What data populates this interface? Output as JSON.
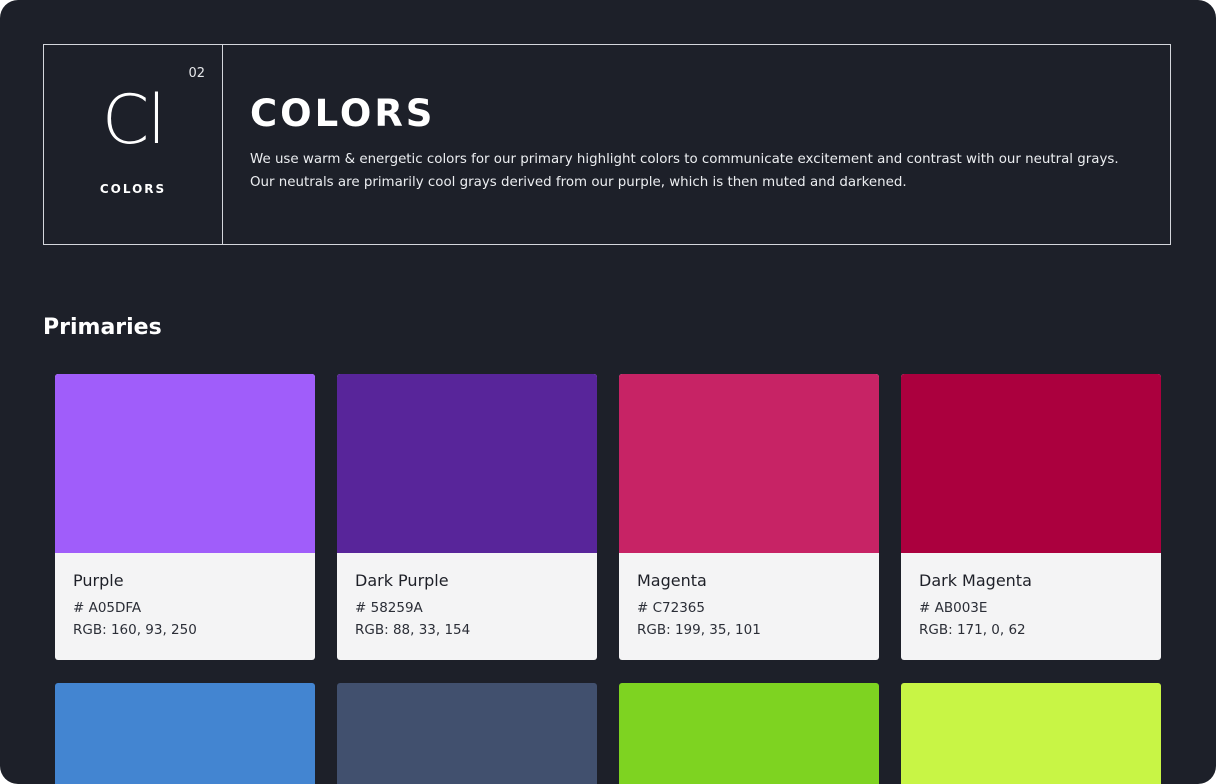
{
  "header": {
    "element_number": "02",
    "element_symbol": "Cl",
    "element_name": "COLORS",
    "title": "COLORS",
    "description_line1": "We use warm & energetic colors for our primary highlight colors to communicate excitement and contrast with our neutral grays.",
    "description_line2": "Our neutrals are primarily cool grays derived from our purple, which is then muted and darkened."
  },
  "section": {
    "title": "Primaries"
  },
  "swatches": [
    {
      "name": "Purple",
      "hex": "# A05DFA",
      "rgb": "RGB: 160, 93, 250",
      "color": "#a05dfa"
    },
    {
      "name": "Dark Purple",
      "hex": "# 58259A",
      "rgb": "RGB: 88, 33, 154",
      "color": "#58259a"
    },
    {
      "name": "Magenta",
      "hex": "# C72365",
      "rgb": "RGB: 199, 35, 101",
      "color": "#c72365"
    },
    {
      "name": "Dark Magenta",
      "hex": "# AB003E",
      "rgb": "RGB: 171, 0, 62",
      "color": "#ab003e"
    }
  ],
  "swatches_row2_colors": [
    "#4385d1",
    "#41506e",
    "#7ed321",
    "#c8f545"
  ],
  "colors": {
    "background": "#1d2029",
    "border": "#d4d6dc",
    "card_body": "#f4f4f5"
  }
}
